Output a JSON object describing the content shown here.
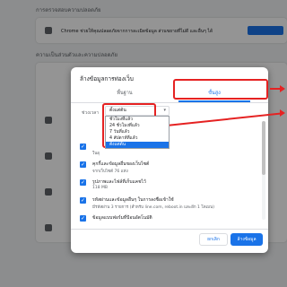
{
  "background": {
    "section1_heading": "การตรวจสอบความปลอดภัย",
    "section1_text": "Chrome ช่วยให้คุณปลอดภัยจากการละเมิดข้อมูล ส่วนขยายที่ไม่ดี และอื่นๆ ได้",
    "section1_button": "ตรวจสอบเลย",
    "section2_heading": "ความเป็นส่วนตัวและความปลอดภัย"
  },
  "dialog": {
    "title": "ล้างข้อมูลการท่องเว็บ",
    "tabs": [
      {
        "label": "พื้นฐาน",
        "active": false
      },
      {
        "label": "ขั้นสูง",
        "active": true
      }
    ],
    "time_range_label": "ช่วงเวลา",
    "time_range_value": "ตั้งแต่ต้น",
    "time_range_options": [
      {
        "label": "ชั่วโมงที่แล้ว",
        "selected": false
      },
      {
        "label": "24 ชั่วโมงที่แล้ว",
        "selected": false
      },
      {
        "label": "7 วันที่แล้ว",
        "selected": false
      },
      {
        "label": "4 สัปดาห์ที่แล้ว",
        "selected": false
      },
      {
        "label": "ตั้งแต่ต้น",
        "selected": true
      }
    ],
    "items": [
      {
        "title": "",
        "desc": "ในอุ",
        "checked": true
      },
      {
        "title": "คุกกี้และข้อมูลอื่นของเว็บไซต์",
        "desc": "จากเว็บไซต์ 76 แห่ง",
        "checked": true
      },
      {
        "title": "รูปภาพและไฟล์ที่เก็บแคชไว้",
        "desc": "118 MB",
        "checked": true
      },
      {
        "title": "รหัสผ่านและข้อมูลอื่นๆ ในการลงชื่อเข้าใช้",
        "desc": "มีรหัสผ่าน 3 รายการ (สำหรับ line.com, reboot.in และอีก 1 โดเมน)",
        "checked": true
      },
      {
        "title": "ข้อมูลแบบฟอร์มที่ป้อนอัตโนมัติ",
        "desc": "",
        "checked": true
      }
    ],
    "cancel_label": "ยกเลิก",
    "clear_label": "ล้างข้อมูล"
  },
  "colors": {
    "accent": "#1a73e8",
    "annotation": "#e52222"
  }
}
